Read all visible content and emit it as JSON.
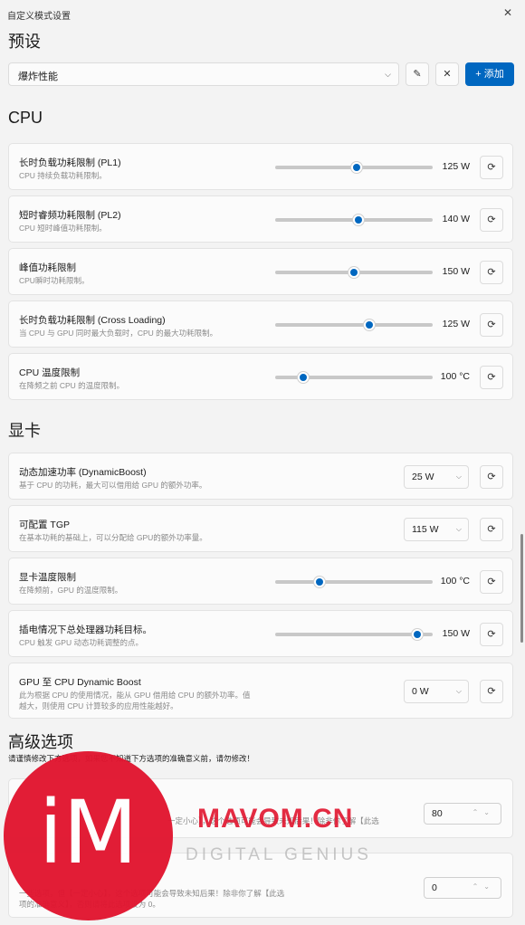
{
  "window": {
    "title": "自定义模式设置",
    "close_glyph": "✕"
  },
  "preset": {
    "heading": "预设",
    "selected": "爆炸性能",
    "edit_glyph": "✎",
    "delete_glyph": "✕",
    "add_label": "+ 添加"
  },
  "cpu": {
    "heading": "CPU",
    "items": [
      {
        "label": "长时负载功耗限制 (PL1)",
        "desc": "CPU 持续负载功耗限制。",
        "value": "125 W",
        "level": 0.52
      },
      {
        "label": "短时睿频功耗限制 (PL2)",
        "desc": "CPU 短时峰值功耗限制。",
        "value": "140 W",
        "level": 0.53
      },
      {
        "label": "峰值功耗限制",
        "desc": "CPU瞬时功耗限制。",
        "value": "150 W",
        "level": 0.5
      },
      {
        "label": "长时负载功耗限制 (Cross Loading)",
        "desc": "当 CPU 与 GPU 同时最大负载时，CPU 的最大功耗限制。",
        "value": "125 W",
        "level": 0.6
      },
      {
        "label": "CPU 温度限制",
        "desc": "在降频之前 CPU 的温度限制。",
        "value": "100 °C",
        "level": 0.18
      }
    ]
  },
  "gpu": {
    "heading": "显卡",
    "dynamic_boost": {
      "label": "动态加速功率 (DynamicBoost)",
      "desc": "基于 CPU 的功耗，最大可以借用给 GPU 的额外功率。",
      "value": "25 W"
    },
    "tgp": {
      "label": "可配置 TGP",
      "desc": "在基本功耗的基础上，可以分配给 GPU的额外功率量。",
      "value": "115 W"
    },
    "temp": {
      "label": "显卡温度限制",
      "desc": "在降频前，GPU 的温度限制。",
      "value": "100 °C",
      "level": 0.28
    },
    "plugged": {
      "label": "插电情况下总处理器功耗目标。",
      "desc": "CPU 触发 GPU 动态功耗调整的点。",
      "value": "150 W",
      "level": 0.9
    },
    "gpu_to_cpu": {
      "label": "GPU 至 CPU Dynamic Boost",
      "desc1": "此为根据 CPU 的使用情况，能从 GPU 借用给 CPU 的额外功率。值",
      "desc2": "越大，则使用 CPU 计算较多的应用性能越好。",
      "value": "0 W"
    }
  },
  "advanced": {
    "heading": "高级选项",
    "note": "请谨慎修改下方选项，如果您不知道下方选项的准确意义前，请勿修改！",
    "item1": {
      "desc": "一定小心】，这个选项可能会导致未知后果！除非你了解【此选",
      "value": "80"
    },
    "item2": {
      "desc1": "一些选项，但【一定小心】，这个选项可能会导致未知后果！除非你了解【此选",
      "desc2": "项的准确意义】，否则请将此选项设为 0。",
      "value": "0"
    }
  },
  "icons": {
    "reset": "⟳",
    "chevron": "⌵",
    "spin": "⌃⌄"
  },
  "watermark": {
    "logo": "iM",
    "brand": "MAVOM.CN",
    "tagline": "DIGITAL GENIUS"
  },
  "colors": {
    "accent": "#0067c0",
    "watermark_red": "#e1152f"
  }
}
